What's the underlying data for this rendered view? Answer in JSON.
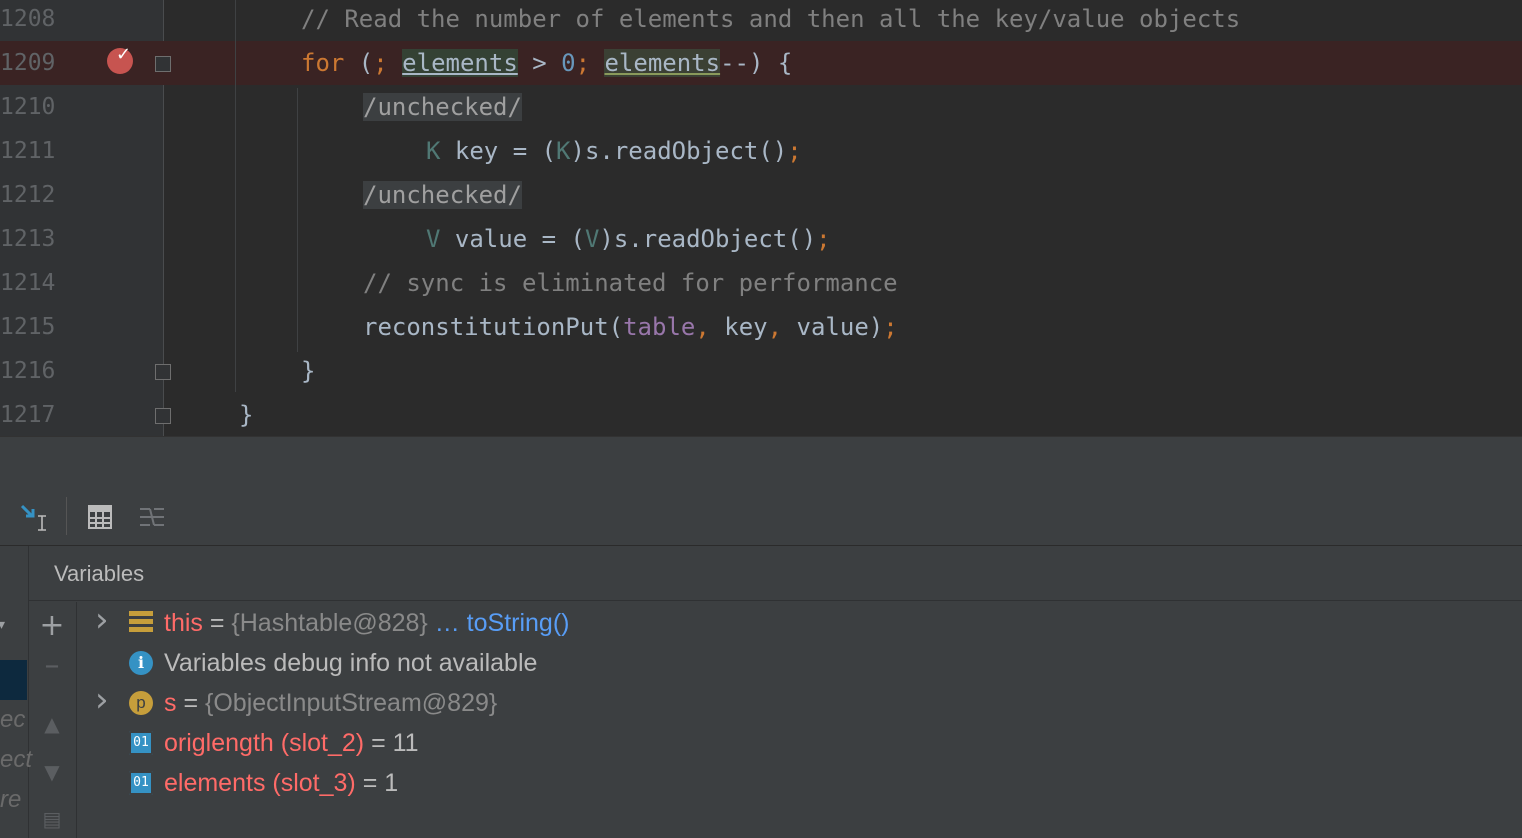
{
  "editor": {
    "lines": [
      {
        "num": "1208",
        "indent": 125,
        "tokens": [
          {
            "t": "// Read the number of elements and then all the key/value objects",
            "c": "cm"
          }
        ]
      },
      {
        "num": "1209",
        "indent": 125,
        "breakpoint": true,
        "tokens": [
          {
            "t": "for",
            "c": "kw"
          },
          {
            "t": " (",
            "c": ""
          },
          {
            "t": ";",
            "c": "kw"
          },
          {
            "t": " ",
            "c": ""
          },
          {
            "t": "elements",
            "c": "hl2"
          },
          {
            "t": " > ",
            "c": ""
          },
          {
            "t": "0",
            "c": "num"
          },
          {
            "t": ";",
            "c": "kw"
          },
          {
            "t": " ",
            "c": ""
          },
          {
            "t": "elements",
            "c": "hl"
          },
          {
            "t": "--) {",
            "c": ""
          }
        ]
      },
      {
        "num": "1210",
        "indent": 187,
        "tokens": [
          {
            "t": "/unchecked/",
            "c": "unchk"
          }
        ]
      },
      {
        "num": "1211",
        "indent": 250,
        "tokens": [
          {
            "t": "K",
            "c": "tp"
          },
          {
            "t": " key = (",
            "c": ""
          },
          {
            "t": "K",
            "c": "tp"
          },
          {
            "t": ")s.readObject()",
            "c": ""
          },
          {
            "t": ";",
            "c": "kw"
          }
        ]
      },
      {
        "num": "1212",
        "indent": 187,
        "tokens": [
          {
            "t": "/unchecked/",
            "c": "unchk"
          }
        ]
      },
      {
        "num": "1213",
        "indent": 250,
        "tokens": [
          {
            "t": "V",
            "c": "tp"
          },
          {
            "t": " value = (",
            "c": ""
          },
          {
            "t": "V",
            "c": "tp"
          },
          {
            "t": ")s.readObject()",
            "c": ""
          },
          {
            "t": ";",
            "c": "kw"
          }
        ]
      },
      {
        "num": "1214",
        "indent": 187,
        "tokens": [
          {
            "t": "// sync is eliminated for performance",
            "c": "cm"
          }
        ]
      },
      {
        "num": "1215",
        "indent": 187,
        "tokens": [
          {
            "t": "reconstitutionPut(",
            "c": ""
          },
          {
            "t": "table",
            "c": "fld"
          },
          {
            "t": ", ",
            "c": "kw"
          },
          {
            "t": "key",
            "c": ""
          },
          {
            "t": ", ",
            "c": "kw"
          },
          {
            "t": "value)",
            "c": ""
          },
          {
            "t": ";",
            "c": "kw"
          }
        ]
      },
      {
        "num": "1216",
        "indent": 125,
        "tokens": [
          {
            "t": "}",
            "c": ""
          }
        ]
      },
      {
        "num": "1217",
        "indent": 63,
        "tokens": [
          {
            "t": "}",
            "c": ""
          }
        ]
      }
    ]
  },
  "debug": {
    "panel_title": "Variables",
    "ghost_text": [
      "ec",
      "ect",
      "re"
    ],
    "variables": [
      {
        "expandable": true,
        "icon": "object-fields-icon",
        "name": "this",
        "eq": " = ",
        "type": "{Hashtable@828}",
        "link": " … toString()"
      },
      {
        "expandable": false,
        "icon": "info-icon",
        "message": "Variables debug info not available"
      },
      {
        "expandable": true,
        "icon": "parameter-icon",
        "icon_letter": "p",
        "name": "s",
        "eq": " = ",
        "type": "{ObjectInputStream@829}"
      },
      {
        "expandable": false,
        "icon": "primitive-icon",
        "icon_letter": "01",
        "name": "origlength (slot_2)",
        "eq": " = ",
        "value": "11"
      },
      {
        "expandable": false,
        "icon": "primitive-icon",
        "icon_letter": "01",
        "name": "elements (slot_3)",
        "eq": " = ",
        "value": "1"
      }
    ]
  },
  "colors": {
    "background": "#2b2b2b",
    "panel": "#3c3f41",
    "breakpoint": "#c75450",
    "var_name": "#ff6b68",
    "link": "#589df6"
  }
}
